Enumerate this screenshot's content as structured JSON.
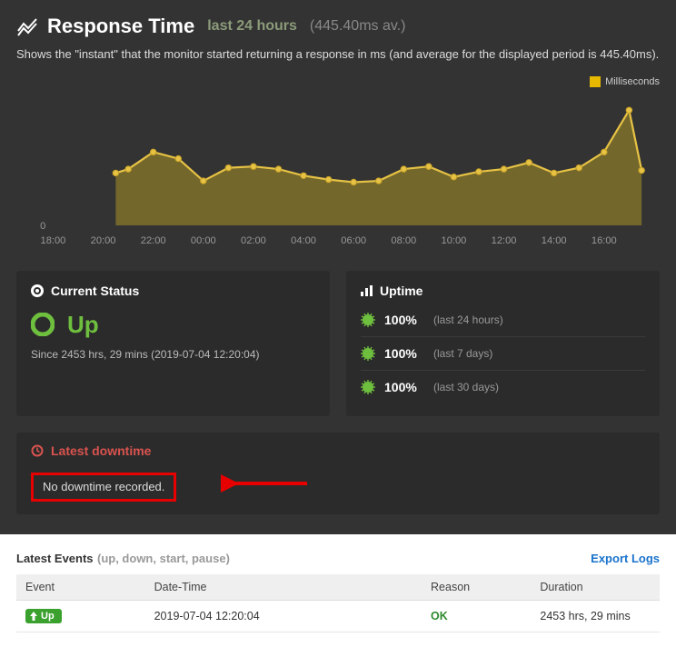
{
  "header": {
    "title": "Response Time",
    "subtitle": "last 24 hours",
    "average_text": "(445.40ms av.)"
  },
  "description": "Shows the \"instant\" that the monitor started returning a response in ms (and average for the displayed period is 445.40ms).",
  "legend_label": "Milliseconds",
  "chart_data": {
    "type": "area",
    "xlabel": "",
    "ylabel": "",
    "x_ticks": [
      "18:00",
      "20:00",
      "22:00",
      "00:00",
      "02:00",
      "04:00",
      "06:00",
      "08:00",
      "10:00",
      "12:00",
      "14:00",
      "16:00"
    ],
    "ylim": [
      0,
      1000
    ],
    "series": [
      {
        "name": "Milliseconds",
        "color": "#d4af37",
        "x": [
          "20:30",
          "21:00",
          "22:00",
          "23:00",
          "00:00",
          "01:00",
          "02:00",
          "03:00",
          "04:00",
          "05:00",
          "06:00",
          "07:00",
          "08:00",
          "09:00",
          "10:00",
          "11:00",
          "12:00",
          "13:00",
          "14:00",
          "15:00",
          "16:00",
          "17:00",
          "17:30"
        ],
        "values": [
          400,
          430,
          560,
          510,
          340,
          440,
          450,
          430,
          380,
          350,
          330,
          340,
          430,
          450,
          370,
          410,
          430,
          480,
          400,
          440,
          560,
          880,
          420
        ]
      }
    ]
  },
  "current_status": {
    "heading": "Current Status",
    "state": "Up",
    "since_text": "Since 2453 hrs, 29 mins (2019-07-04 12:20:04)"
  },
  "uptime": {
    "heading": "Uptime",
    "rows": [
      {
        "pct": "100%",
        "period": "(last 24 hours)"
      },
      {
        "pct": "100%",
        "period": "(last 7 days)"
      },
      {
        "pct": "100%",
        "period": "(last 30 days)"
      }
    ]
  },
  "downtime": {
    "heading": "Latest downtime",
    "message": "No downtime recorded."
  },
  "events": {
    "title": "Latest Events",
    "sub": "(up, down, start, pause)",
    "export_label": "Export Logs",
    "columns": {
      "event": "Event",
      "datetime": "Date-Time",
      "reason": "Reason",
      "duration": "Duration"
    },
    "rows": [
      {
        "event_label": "Up",
        "datetime": "2019-07-04 12:20:04",
        "reason": "OK",
        "duration": "2453 hrs, 29 mins"
      }
    ]
  }
}
